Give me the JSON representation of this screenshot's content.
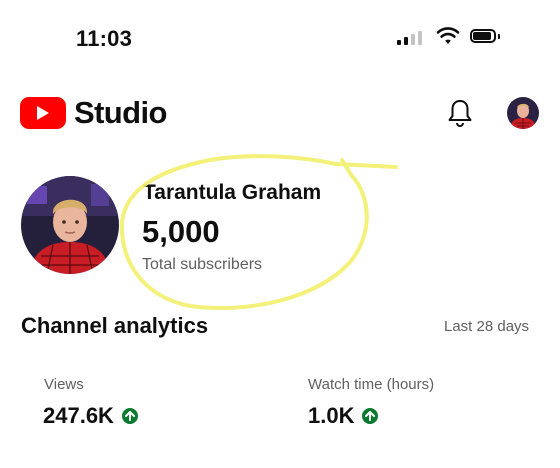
{
  "status_bar": {
    "time": "11:03"
  },
  "header": {
    "app_name": "Studio",
    "bell_icon": "notification-bell-icon",
    "account_icon": "account-avatar"
  },
  "channel": {
    "name": "Tarantula Graham",
    "subscriber_count": "5,000",
    "subscriber_label": "Total subscribers"
  },
  "analytics": {
    "title": "Channel analytics",
    "period": "Last 28 days",
    "metrics": [
      {
        "label": "Views",
        "value": "247.6K",
        "trend": "up-arrow-icon"
      },
      {
        "label": "Watch time (hours)",
        "value": "1.0K",
        "trend": "up-arrow-icon"
      }
    ]
  },
  "colors": {
    "brand_red": "#ff0000",
    "trend_green": "#0a7a2f",
    "highlight_yellow": "#f2f06a"
  }
}
